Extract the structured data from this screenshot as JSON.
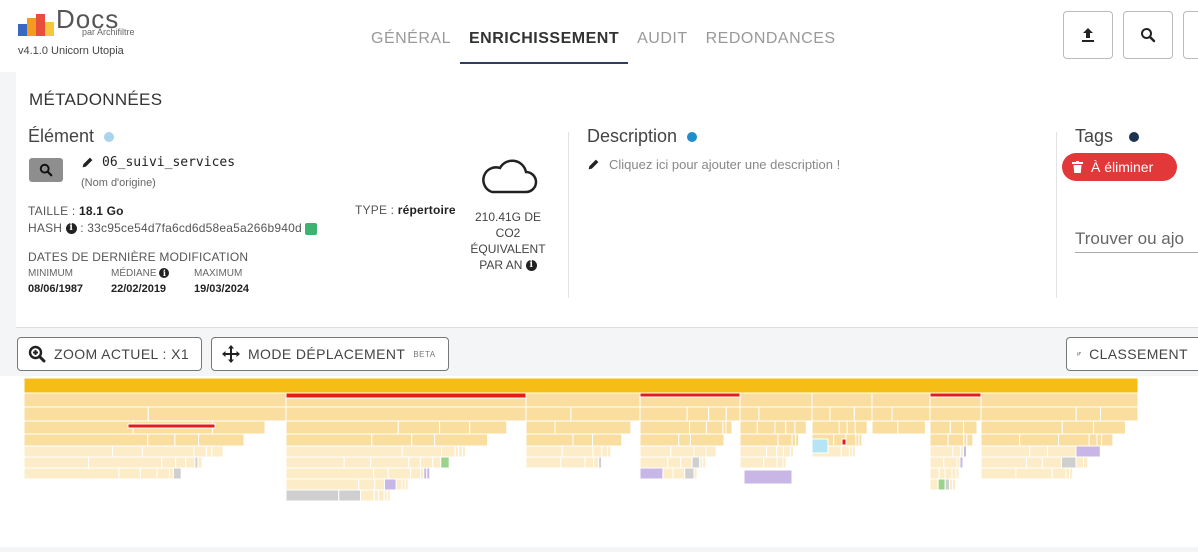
{
  "app": {
    "logo_text": "Docs",
    "logo_sub": "par Archifiltre",
    "version": "v4.1.0 Unicorn Utopia"
  },
  "nav": {
    "tabs": [
      {
        "label": "GÉNÉRAL",
        "active": false
      },
      {
        "label": "ENRICHISSEMENT",
        "active": true
      },
      {
        "label": "AUDIT",
        "active": false
      },
      {
        "label": "REDONDANCES",
        "active": false
      }
    ]
  },
  "header_buttons": [
    "upload-icon",
    "search-icon"
  ],
  "metadata": {
    "title": "MÉTADONNÉES",
    "element": {
      "section_title": "Élément",
      "name": "06_suivi_services",
      "original_name": "(Nom d'origine)",
      "size_label": "TAILLE :",
      "size_value": "18.1 Go",
      "type_label": "TYPE :",
      "type_value": "répertoire",
      "hash_label": ": 33c95ce54d7fa6cd6d58ea5a266b940d",
      "hash_prefix": "HASH",
      "dates_title": "DATES DE DERNIÈRE MODIFICATION",
      "dates": [
        {
          "label": "MINIMUM",
          "value": "08/06/1987",
          "info": false
        },
        {
          "label": "MÉDIANE",
          "value": "22/02/2019",
          "info": true
        },
        {
          "label": "MAXIMUM",
          "value": "19/03/2024",
          "info": false
        }
      ],
      "co2_line1": "210.41G DE",
      "co2_line2": "CO2",
      "co2_line3": "ÉQUIVALENT",
      "co2_line4": "PAR AN"
    },
    "description": {
      "section_title": "Description",
      "placeholder": "Cliquez ici pour ajouter une description !"
    },
    "tags": {
      "section_title": "Tags",
      "tag_label": "À éliminer",
      "input_placeholder": "Trouver ou ajo"
    },
    "colors": {
      "element_dot": "#a8d4ee",
      "description_dot": "#1f8dc9",
      "tags_dot": "#1d3352",
      "tag_red": "#e3383a"
    }
  },
  "toolbar": {
    "zoom_label": "ZOOM ACTUEL : X1",
    "move_label": "MODE DÉPLACEMENT",
    "move_badge": "BETA",
    "sort_label": "CLASSEMENT"
  },
  "treemap": {
    "colors": {
      "root": "#f6bd16",
      "folder": "#f9dea0",
      "folder_light": "#fcecc8",
      "tagged": "#e01c1c",
      "image": "#c8b7e6",
      "other": "#cfcfcf",
      "green": "#9ad48a",
      "cyan": "#b5e5f4"
    }
  }
}
